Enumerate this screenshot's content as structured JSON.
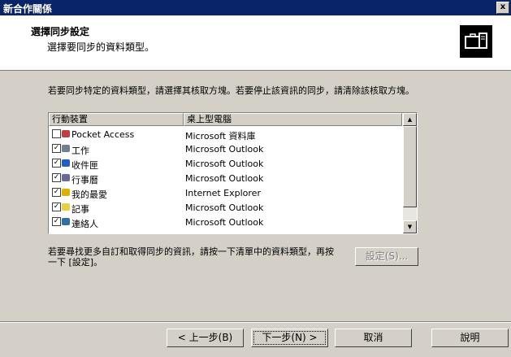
{
  "window": {
    "title": "新合作關係",
    "close_label": "x"
  },
  "header": {
    "heading": "選擇同步設定",
    "subheading": "選擇要同步的資料類型。",
    "logo_icon": "sync-briefcase-icon"
  },
  "instructions": "若要同步特定的資料類型，請選擇其核取方塊。若要停止該資訊的同步，請清除該核取方塊。",
  "list": {
    "columns": [
      "行動裝置",
      "桌上型電腦"
    ],
    "rows": [
      {
        "checked": false,
        "icon": "pocket-access-icon",
        "device": "Pocket Access",
        "desktop": "Microsoft 資料庫"
      },
      {
        "checked": true,
        "icon": "tasks-icon",
        "device": "工作",
        "desktop": "Microsoft Outlook"
      },
      {
        "checked": true,
        "icon": "inbox-icon",
        "device": "收件匣",
        "desktop": "Microsoft Outlook"
      },
      {
        "checked": true,
        "icon": "calendar-icon",
        "device": "行事曆",
        "desktop": "Microsoft Outlook"
      },
      {
        "checked": true,
        "icon": "favorites-icon",
        "device": "我的最愛",
        "desktop": "Internet Explorer"
      },
      {
        "checked": true,
        "icon": "notes-icon",
        "device": "記事",
        "desktop": "Microsoft Outlook"
      },
      {
        "checked": true,
        "icon": "contacts-icon",
        "device": "連絡人",
        "desktop": "Microsoft Outlook"
      }
    ]
  },
  "hint": "若要尋找更多自訂和取得同步的資訊，請按一下清單中的資料類型，再按一下 [設定]。",
  "buttons": {
    "settings": "設定(S)...",
    "back": "< 上一步(B)",
    "next": "下一步(N) >",
    "cancel": "取消",
    "help": "說明"
  },
  "colors": {
    "titlebar": "#0a246a",
    "face": "#d4d0c8"
  }
}
